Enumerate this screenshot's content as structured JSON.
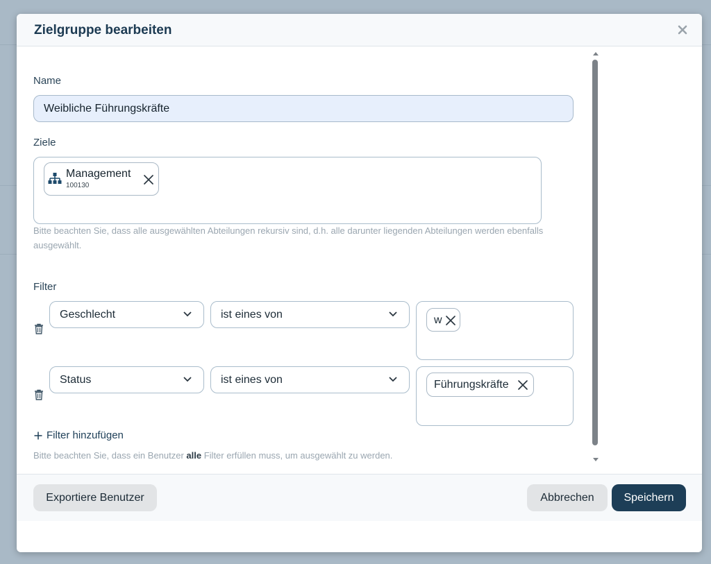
{
  "dialog": {
    "title": "Zielgruppe bearbeiten"
  },
  "name_section": {
    "label": "Name",
    "value": "Weibliche Führungskräfte"
  },
  "ziele_section": {
    "label": "Ziele",
    "chips": [
      {
        "label": "Management",
        "code": "100130",
        "icon": "org-chart-icon"
      }
    ],
    "hint": "Bitte beachten Sie, dass alle ausgewählten Abteilungen rekursiv sind, d.h. alle darunter liegenden Abteilungen werden ebenfalls ausgewählt."
  },
  "filter_section": {
    "label": "Filter",
    "rows": [
      {
        "field": "Geschlecht",
        "operator": "ist eines von",
        "values": [
          "w"
        ]
      },
      {
        "field": "Status",
        "operator": "ist eines von",
        "values": [
          "Führungskräfte"
        ]
      }
    ],
    "add_label": "Filter hinzufügen",
    "hint_prefix": "Bitte beachten Sie, dass ein Benutzer ",
    "hint_bold": "alle",
    "hint_suffix": " Filter erfüllen muss, um ausgewählt zu werden."
  },
  "footer": {
    "export_label": "Exportiere Benutzer",
    "cancel_label": "Abbrechen",
    "save_label": "Speichern"
  },
  "colors": {
    "primary": "#1d3e57",
    "name_input_bg": "#e7effc"
  }
}
